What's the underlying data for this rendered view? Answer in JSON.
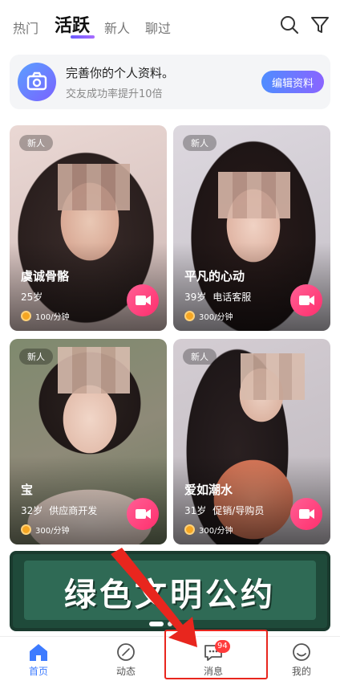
{
  "top_tabs": [
    {
      "label": "热门",
      "active": false
    },
    {
      "label": "活跃",
      "active": true
    },
    {
      "label": "新人",
      "active": false
    },
    {
      "label": "聊过",
      "active": false
    }
  ],
  "icons": {
    "search": "search-icon",
    "filter": "filter-icon"
  },
  "profile_banner": {
    "title": "完善你的个人资料。",
    "subtitle": "交友成功率提升10倍",
    "button": "编辑资料",
    "icon": "camera-icon"
  },
  "cards": [
    {
      "badge": "新人",
      "name": "虞诚骨骼",
      "age": "25岁",
      "job": "",
      "price": "100/分钟"
    },
    {
      "badge": "新人",
      "name": "平凡的心动",
      "age": "39岁",
      "job": "电话客服",
      "price": "300/分钟"
    },
    {
      "badge": "新人",
      "name": "宝",
      "age": "32岁",
      "job": "供应商开发",
      "price": "300/分钟"
    },
    {
      "badge": "新人",
      "name": "爱如潮水",
      "age": "31岁",
      "job": "促销/导购员",
      "price": "300/分钟"
    }
  ],
  "ad_banner": {
    "text": "绿色文明公约"
  },
  "bottom_nav": [
    {
      "label": "首页",
      "icon": "home-icon",
      "active": true
    },
    {
      "label": "动态",
      "icon": "compass-icon",
      "active": false
    },
    {
      "label": "消息",
      "icon": "message-icon",
      "active": false,
      "badge": "94"
    },
    {
      "label": "我的",
      "icon": "profile-icon",
      "active": false
    }
  ],
  "colors": {
    "accent_blue": "#3d7bff",
    "accent_purple": "#8a64ff",
    "video_pink": "#ff2f6d",
    "annotation_red": "#e8261e",
    "badge_red": "#ff3b3b"
  }
}
